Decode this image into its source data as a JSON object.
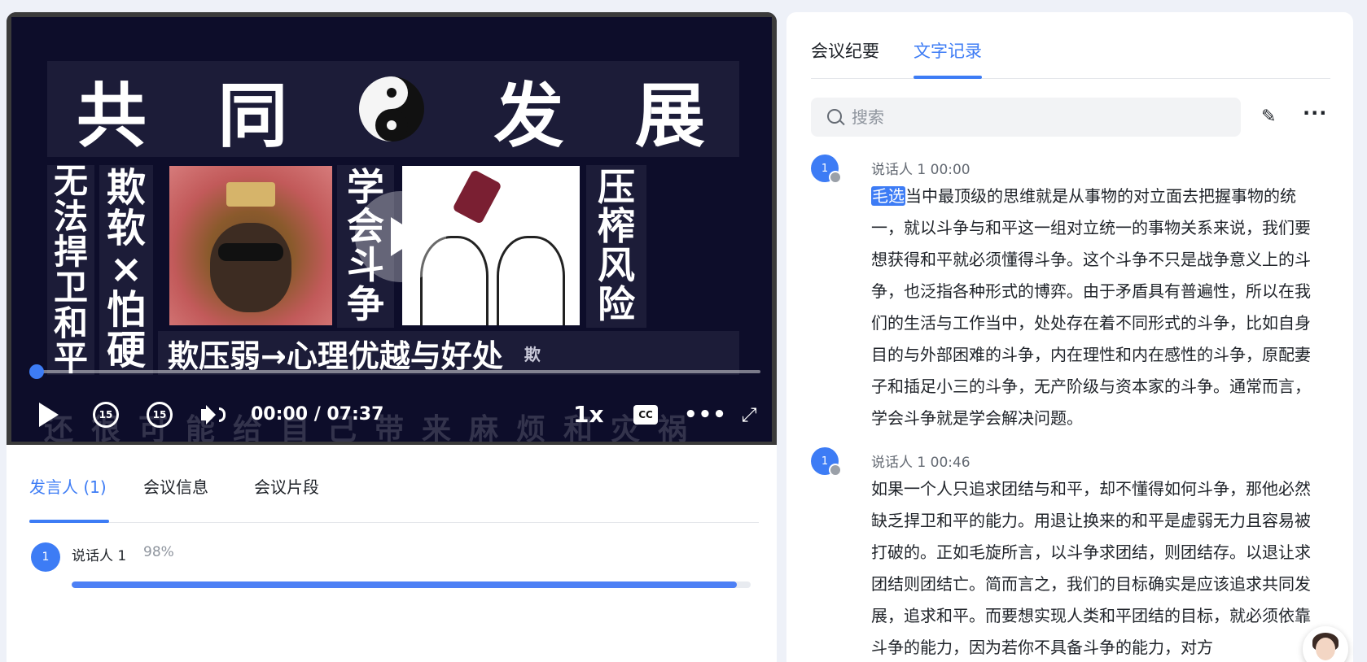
{
  "video": {
    "title_chars": [
      "共",
      "同",
      "发",
      "展"
    ],
    "col1": [
      "无",
      "法",
      "捍",
      "卫",
      "和",
      "平"
    ],
    "col2": [
      "欺",
      "软",
      "×",
      "怕",
      "硬"
    ],
    "col3": [
      "学",
      "会",
      "斗",
      "争"
    ],
    "col5": [
      "压",
      "榨",
      "风",
      "险"
    ],
    "bottom_banner": "欺压弱→心理优越与好处",
    "bottom_small": "欺",
    "subtitle": "还很可能给自己带来麻烦和灾祸",
    "time_display": "00:00 / 07:37",
    "skip_back_label": "15",
    "skip_fwd_label": "15",
    "speed": "1x",
    "cc_label": "CC",
    "more_label": "•••",
    "progress_fraction": 0.0
  },
  "left_tabs": {
    "speakers": "发言人 (1)",
    "meeting_info": "会议信息",
    "meeting_clips": "会议片段"
  },
  "speaker_stats": [
    {
      "avatar": "1",
      "name": "说话人 1",
      "percent": "98%",
      "fraction": 0.98
    }
  ],
  "right_tabs": {
    "summary": "会议纪要",
    "transcript": "文字记录"
  },
  "search": {
    "placeholder": "搜索"
  },
  "transcript": [
    {
      "avatar": "1",
      "meta": "说话人 1  00:00",
      "highlight": "毛选",
      "text": "当中最顶级的思维就是从事物的对立面去把握事物的统一，就以斗争与和平这一组对立统一的事物关系来说，我们要想获得和平就必须懂得斗争。这个斗争不只是战争意义上的斗争，也泛指各种形式的博弈。由于矛盾具有普遍性，所以在我们的生活与工作当中，处处存在着不同形式的斗争，比如自身目的与外部困难的斗争，内在理性和内在感性的斗争，原配妻子和插足小三的斗争，无产阶级与资本家的斗争。通常而言，学会斗争就是学会解决问题。"
    },
    {
      "avatar": "1",
      "meta": "说话人 1  00:46",
      "highlight": "",
      "text": "如果一个人只追求团结与和平，却不懂得如何斗争，那他必然缺乏捍卫和平的能力。用退让换来的和平是虚弱无力且容易被打破的。正如毛旋所言，以斗争求团结，则团结存。以退让求团结则团结亡。简而言之，我们的目标确实是应该追求共同发展，追求和平。而要想实现人类和平团结的目标，就必须依靠斗争的能力，因为若你不具备斗争的能力，对方"
    }
  ],
  "colors": {
    "accent": "#3d7cf5",
    "background": "#eef1f8"
  }
}
